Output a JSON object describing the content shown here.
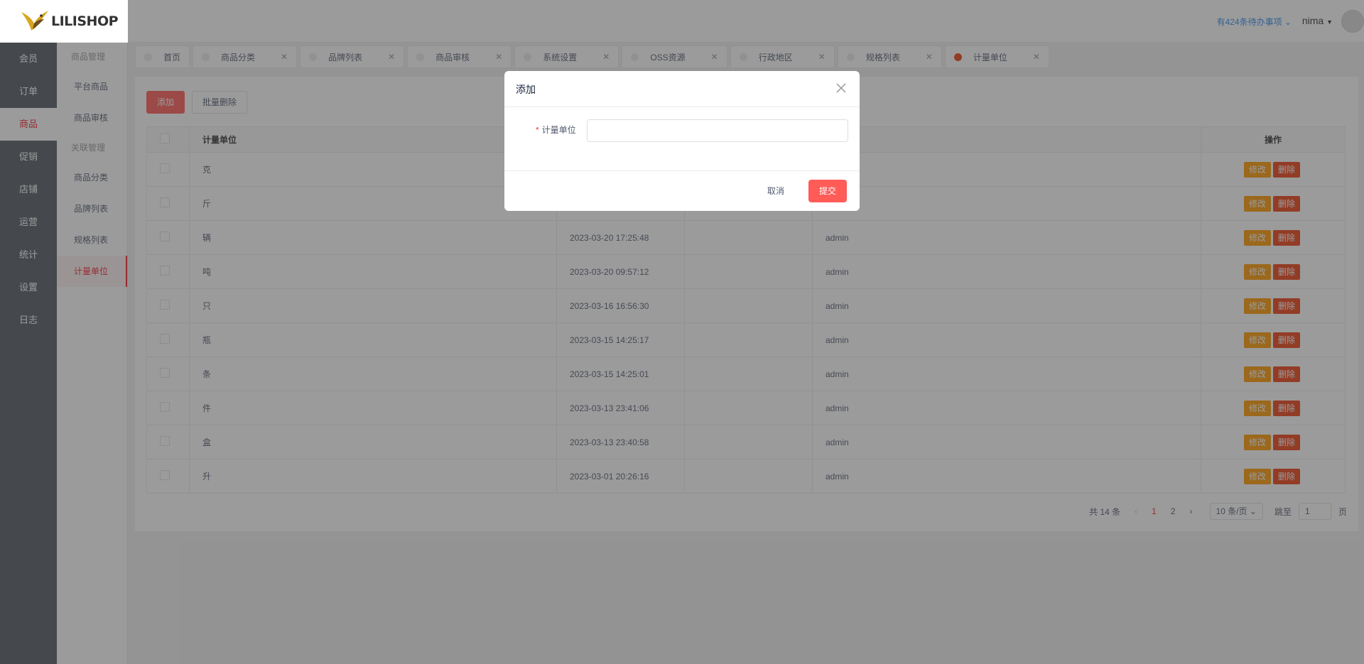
{
  "app": {
    "logo_text": "LILISHOP"
  },
  "header": {
    "todo": "有424条待办事项",
    "user": "nima"
  },
  "nav": {
    "main": [
      "会员",
      "订单",
      "商品",
      "促销",
      "店铺",
      "运营",
      "统计",
      "设置",
      "日志"
    ],
    "active_main": "商品",
    "sub_group1": "商品管理",
    "sub_group1_items": [
      "平台商品",
      "商品审核"
    ],
    "sub_group2": "关联管理",
    "sub_group2_items": [
      "商品分类",
      "品牌列表",
      "规格列表",
      "计量单位"
    ],
    "active_sub": "计量单位"
  },
  "tabs": [
    {
      "label": "首页",
      "closable": false
    },
    {
      "label": "商品分类",
      "closable": true
    },
    {
      "label": "品牌列表",
      "closable": true
    },
    {
      "label": "商品审核",
      "closable": true
    },
    {
      "label": "系统设置",
      "closable": true
    },
    {
      "label": "OSS资源",
      "closable": true
    },
    {
      "label": "行政地区",
      "closable": true
    },
    {
      "label": "规格列表",
      "closable": true
    },
    {
      "label": "计量单位",
      "closable": true,
      "active": true
    }
  ],
  "toolbar": {
    "add_label": "添加",
    "batch_delete_label": "批量删除"
  },
  "table": {
    "headers": {
      "unit": "计量单位",
      "actions": "操作"
    },
    "edit_label": "修改",
    "delete_label": "删除",
    "rows": [
      {
        "unit": "克",
        "time": "",
        "creator": ""
      },
      {
        "unit": "斤",
        "time": "",
        "creator": ""
      },
      {
        "unit": "辆",
        "time": "2023-03-20 17:25:48",
        "creator": "admin"
      },
      {
        "unit": "吨",
        "time": "2023-03-20 09:57:12",
        "creator": "admin"
      },
      {
        "unit": "只",
        "time": "2023-03-16 16:56:30",
        "creator": "admin"
      },
      {
        "unit": "瓶",
        "time": "2023-03-15 14:25:17",
        "creator": "admin"
      },
      {
        "unit": "条",
        "time": "2023-03-15 14:25:01",
        "creator": "admin"
      },
      {
        "unit": "件",
        "time": "2023-03-13 23:41:06",
        "creator": "admin"
      },
      {
        "unit": "盒",
        "time": "2023-03-13 23:40:58",
        "creator": "admin"
      },
      {
        "unit": "升",
        "time": "2023-03-01 20:26:16",
        "creator": "admin"
      }
    ]
  },
  "pager": {
    "total": "共 14 条",
    "pages": [
      "1",
      "2"
    ],
    "current": "1",
    "page_size": "10 条/页",
    "jump_label": "跳至",
    "jump_value": "1",
    "page_suffix": "页"
  },
  "modal": {
    "title": "添加",
    "field_label": "计量单位",
    "field_value": "",
    "cancel_label": "取消",
    "submit_label": "提交"
  },
  "colors": {
    "accent": "#ff5c58",
    "sidebar_dark": "#525a63",
    "link_blue": "#2d8cf0"
  }
}
